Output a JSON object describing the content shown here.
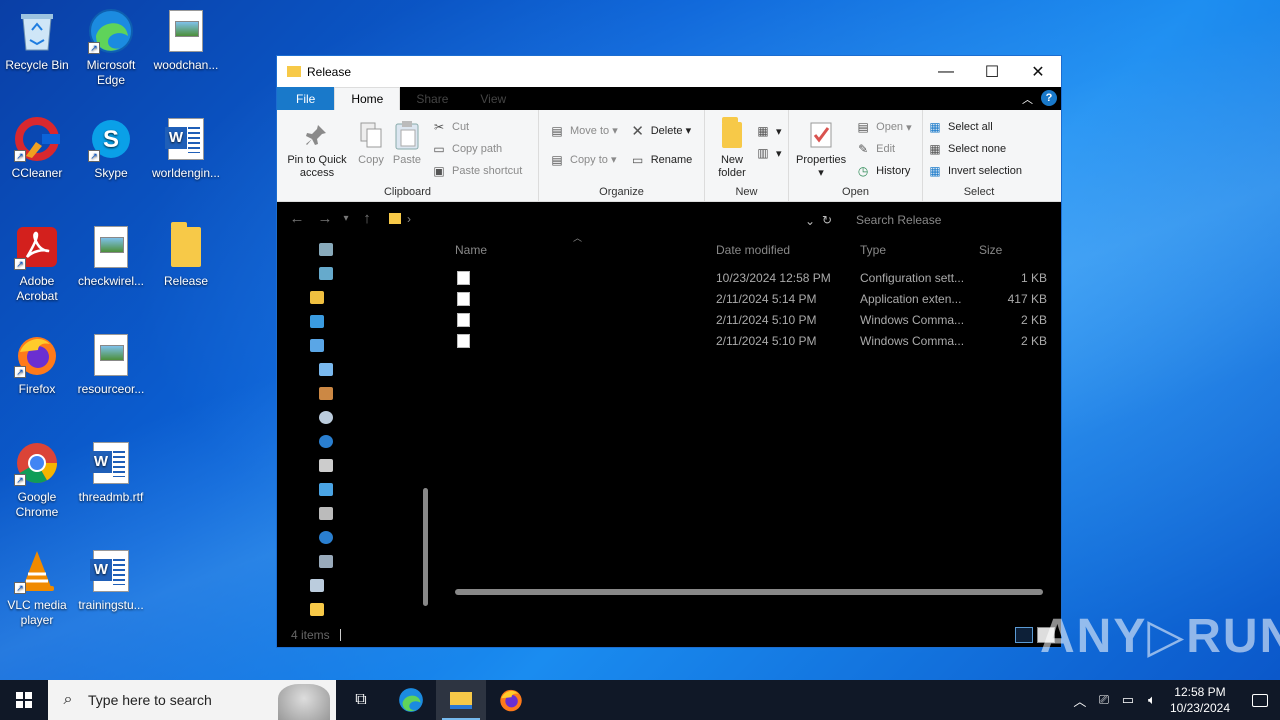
{
  "desktop": {
    "icons": [
      {
        "label": "Recycle Bin",
        "icon": "recycle-bin-icon"
      },
      {
        "label": "Microsoft Edge",
        "icon": "edge-icon"
      },
      {
        "label": "woodchan...",
        "icon": "image-file-icon"
      },
      {
        "label": "CCleaner",
        "icon": "ccleaner-icon"
      },
      {
        "label": "Skype",
        "icon": "skype-icon"
      },
      {
        "label": "worldengin...",
        "icon": "word-doc-icon"
      },
      {
        "label": "Adobe Acrobat",
        "icon": "acrobat-icon"
      },
      {
        "label": "checkwirel...",
        "icon": "image-file-icon"
      },
      {
        "label": "Release",
        "icon": "folder-icon"
      },
      {
        "label": "Firefox",
        "icon": "firefox-icon"
      },
      {
        "label": "resourceor...",
        "icon": "image-file-icon"
      },
      {
        "label": "Google Chrome",
        "icon": "chrome-icon"
      },
      {
        "label": "threadmb.rtf",
        "icon": "word-doc-icon"
      },
      {
        "label": "VLC media player",
        "icon": "vlc-icon"
      },
      {
        "label": "trainingstu...",
        "icon": "word-doc-icon"
      }
    ]
  },
  "window": {
    "title": "Release",
    "tabs": {
      "file": "File",
      "home": "Home",
      "share": "Share",
      "view": "View"
    },
    "ribbon": {
      "clipboard": {
        "label": "Clipboard",
        "pin": "Pin to Quick access",
        "copy": "Copy",
        "paste": "Paste",
        "cut": "Cut",
        "copy_path": "Copy path",
        "paste_shortcut": "Paste shortcut"
      },
      "organize": {
        "label": "Organize",
        "move_to": "Move to",
        "copy_to": "Copy to",
        "delete": "Delete",
        "rename": "Rename"
      },
      "new": {
        "label": "New",
        "new_folder": "New folder"
      },
      "open": {
        "label": "Open",
        "properties": "Properties",
        "open": "Open",
        "edit": "Edit",
        "history": "History"
      },
      "select": {
        "label": "Select",
        "select_all": "Select all",
        "select_none": "Select none",
        "invert": "Invert selection"
      }
    },
    "search_placeholder": "Search Release",
    "columns": {
      "name": "Name",
      "date": "Date modified",
      "type": "Type",
      "size": "Size"
    },
    "files": [
      {
        "date": "10/23/2024 12:58 PM",
        "type": "Configuration sett...",
        "size": "1 KB"
      },
      {
        "date": "2/11/2024 5:14 PM",
        "type": "Application exten...",
        "size": "417 KB"
      },
      {
        "date": "2/11/2024 5:10 PM",
        "type": "Windows Comma...",
        "size": "2 KB"
      },
      {
        "date": "2/11/2024 5:10 PM",
        "type": "Windows Comma...",
        "size": "2 KB"
      }
    ],
    "status": "4 items"
  },
  "watermark": "ANY▷RUN",
  "taskbar": {
    "search_placeholder": "Type here to search",
    "time": "12:58 PM",
    "date": "10/23/2024"
  }
}
